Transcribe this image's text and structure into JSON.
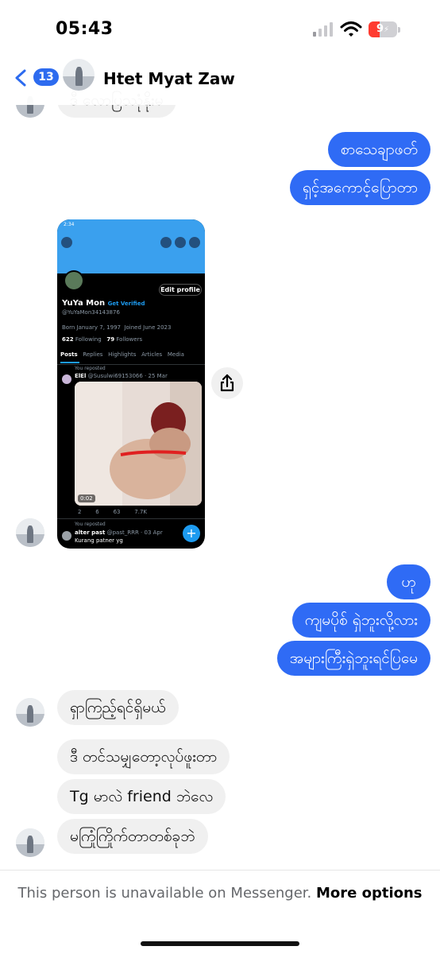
{
  "status_bar": {
    "time": "05:43",
    "battery_level": "9",
    "signal_bars_active": 1,
    "battery_color": "#ff3b30"
  },
  "header": {
    "back_badge_count": "13",
    "contact_name": "Htet Myat Zaw"
  },
  "messages": [
    {
      "id": "m0",
      "from": "them",
      "text": "ဒီ လောပြဿုံနိုးမ"
    },
    {
      "id": "m1",
      "from": "me",
      "text": "စာသေချာဖတ်"
    },
    {
      "id": "m2",
      "from": "me",
      "text": "ရှင့်အကောင့်ပြောတာ"
    },
    {
      "id": "m3",
      "from": "them",
      "type": "image",
      "text": "screenshot"
    },
    {
      "id": "m4",
      "from": "me",
      "text": "ဟု"
    },
    {
      "id": "m5",
      "from": "me",
      "text": "ကျမပိုစ် ရှဲဘူးလို့လား"
    },
    {
      "id": "m6",
      "from": "me",
      "text": "အများကြီးရှဲဘူးရင်ပြမေ"
    },
    {
      "id": "m7",
      "from": "them",
      "text": "ရှာကြည့်ရင်ရှိမယ်"
    },
    {
      "id": "m8",
      "from": "them",
      "text": "ဒီ တင်သမျှတော့လုပ်ဖူးတာ"
    },
    {
      "id": "m9",
      "from": "them",
      "text": "Tg မာလဲ friend ဘဲလေ"
    },
    {
      "id": "m10",
      "from": "them",
      "text": "မကြုံကြိုက်တာတစ်ခုဘဲ"
    }
  ],
  "shared_screenshot": {
    "status_time": "2:34",
    "profile_name": "YuYa Mon",
    "verified_label": "Get Verified",
    "handle": "@YuYaMon34143876",
    "born": "Born January 7, 1997",
    "joined": "Joined June 2023",
    "following_count": "622",
    "following_label": "Following",
    "followers_count": "79",
    "followers_label": "Followers",
    "edit_profile": "Edit profile",
    "tabs": [
      "Posts",
      "Replies",
      "Highlights",
      "Articles",
      "Media"
    ],
    "repost_label": "You reposted",
    "post_author": "ElEl",
    "post_handle": "@Susulwi69153066 · 25 Mar",
    "video_duration": "0:02",
    "stats": [
      "2",
      "6",
      "63",
      "7.7K"
    ],
    "repost2_label": "You reposted",
    "post2_author": "alter past",
    "post2_handle": "@past_RRR · 03 Apr",
    "post2_text": "Kurang patner yg",
    "fab_symbol": "+"
  },
  "footer": {
    "notice": "This person is unavailable on Messenger.",
    "link": "More options"
  },
  "colors": {
    "accent": "#2f6bf5",
    "incoming_bubble": "#f0f0f0"
  }
}
